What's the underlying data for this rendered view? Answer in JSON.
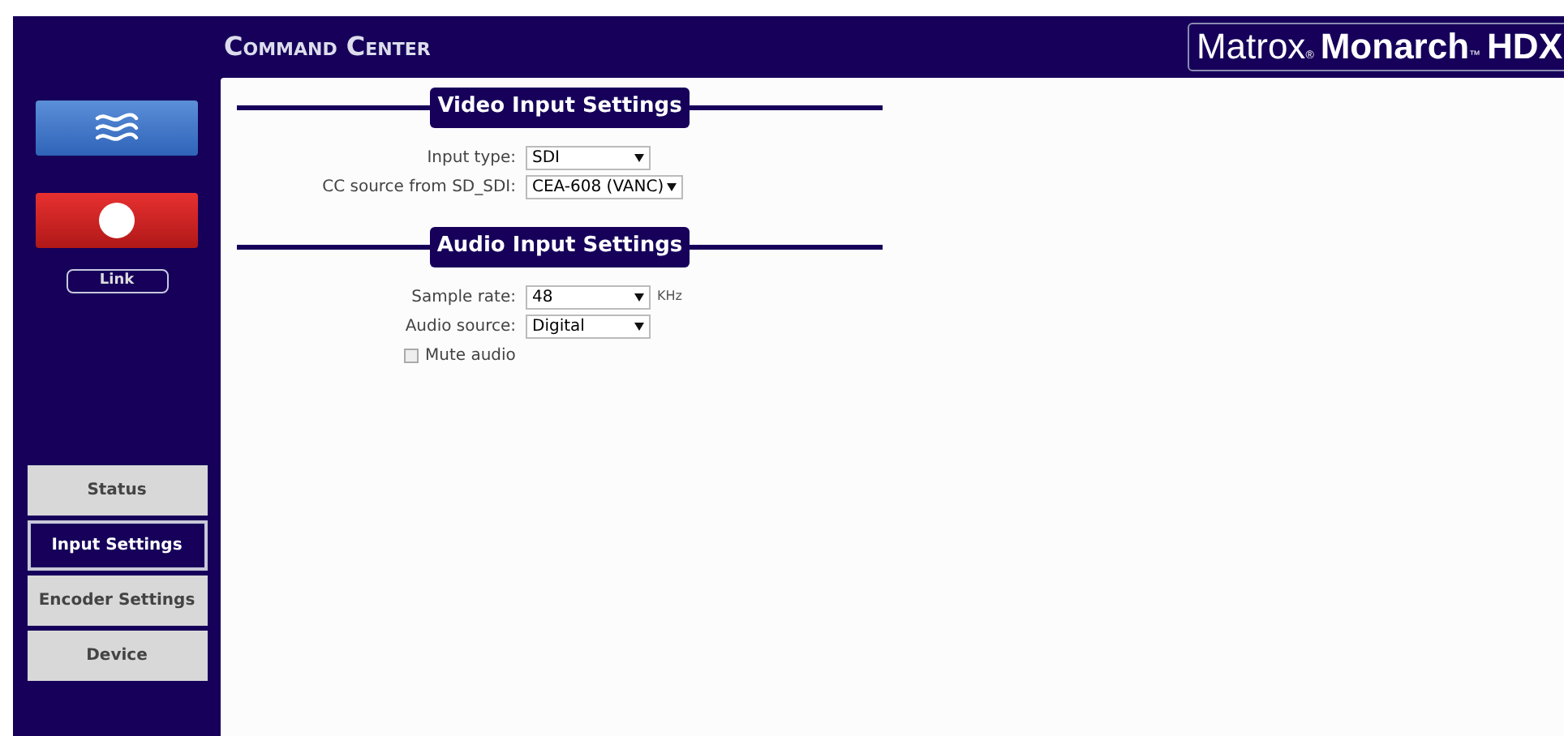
{
  "header": {
    "title": "Command Center",
    "logo": {
      "maker": "Matrox",
      "maker_mark": "®",
      "product": "Monarch",
      "product_mark": "™",
      "model": "HDX"
    }
  },
  "sidebar": {
    "link_button": "Link",
    "nav": [
      {
        "label": "Status",
        "selected": false
      },
      {
        "label": "Input Settings",
        "selected": true
      },
      {
        "label": "Encoder Settings",
        "selected": false
      },
      {
        "label": "Device",
        "selected": false
      }
    ]
  },
  "sections": [
    {
      "title": "Video Input Settings",
      "fields": [
        {
          "kind": "select",
          "label": "Input type:",
          "value": "SDI"
        },
        {
          "kind": "select",
          "label": "CC source from SD_SDI:",
          "value": "CEA-608 (VANC)"
        }
      ]
    },
    {
      "title": "Audio Input Settings",
      "fields": [
        {
          "kind": "select",
          "label": "Sample rate:",
          "value": "48",
          "unit": "KHz"
        },
        {
          "kind": "select",
          "label": "Audio source:",
          "value": "Digital"
        },
        {
          "kind": "checkbox",
          "label": "Mute audio",
          "checked": false
        }
      ]
    }
  ]
}
